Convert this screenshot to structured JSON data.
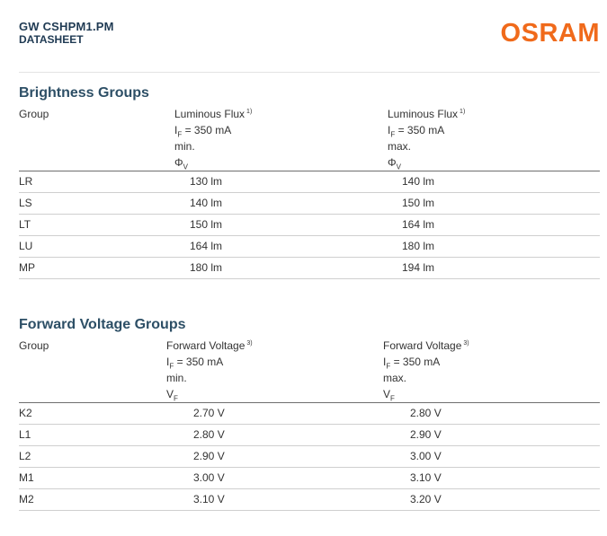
{
  "header": {
    "product": "GW CSHPM1.PM",
    "doctype": "DATASHEET",
    "logo": "OSRAM"
  },
  "brightness": {
    "title": "Brightness Groups",
    "headers": {
      "group": "Group",
      "min": {
        "name": "Luminous Flux",
        "note": "1)",
        "cond_sym": "I",
        "cond_sub": "F",
        "cond_val": " = 350 mA",
        "limit": "min.",
        "sym": "Φ",
        "sym_sub": "V"
      },
      "max": {
        "name": "Luminous Flux",
        "note": "1)",
        "cond_sym": "I",
        "cond_sub": "F",
        "cond_val": " = 350 mA",
        "limit": "max.",
        "sym": "Φ",
        "sym_sub": "V"
      }
    },
    "rows": [
      {
        "group": "LR",
        "min": "130 lm",
        "max": "140 lm"
      },
      {
        "group": "LS",
        "min": "140 lm",
        "max": "150 lm"
      },
      {
        "group": "LT",
        "min": "150 lm",
        "max": "164 lm"
      },
      {
        "group": "LU",
        "min": "164 lm",
        "max": "180 lm"
      },
      {
        "group": "MP",
        "min": "180 lm",
        "max": "194 lm"
      }
    ]
  },
  "voltage": {
    "title": "Forward Voltage Groups",
    "headers": {
      "group": "Group",
      "min": {
        "name": "Forward Voltage",
        "note": "3)",
        "cond_sym": "I",
        "cond_sub": "F",
        "cond_val": " = 350 mA",
        "limit": "min.",
        "sym": "V",
        "sym_sub": "F"
      },
      "max": {
        "name": "Forward Voltage",
        "note": "3)",
        "cond_sym": "I",
        "cond_sub": "F",
        "cond_val": " = 350 mA",
        "limit": "max.",
        "sym": "V",
        "sym_sub": "F"
      }
    },
    "rows": [
      {
        "group": "K2",
        "min": "2.70 V",
        "max": "2.80 V"
      },
      {
        "group": "L1",
        "min": "2.80 V",
        "max": "2.90 V"
      },
      {
        "group": "L2",
        "min": "2.90 V",
        "max": "3.00 V"
      },
      {
        "group": "M1",
        "min": "3.00 V",
        "max": "3.10 V"
      },
      {
        "group": "M2",
        "min": "3.10 V",
        "max": "3.20 V"
      }
    ]
  }
}
